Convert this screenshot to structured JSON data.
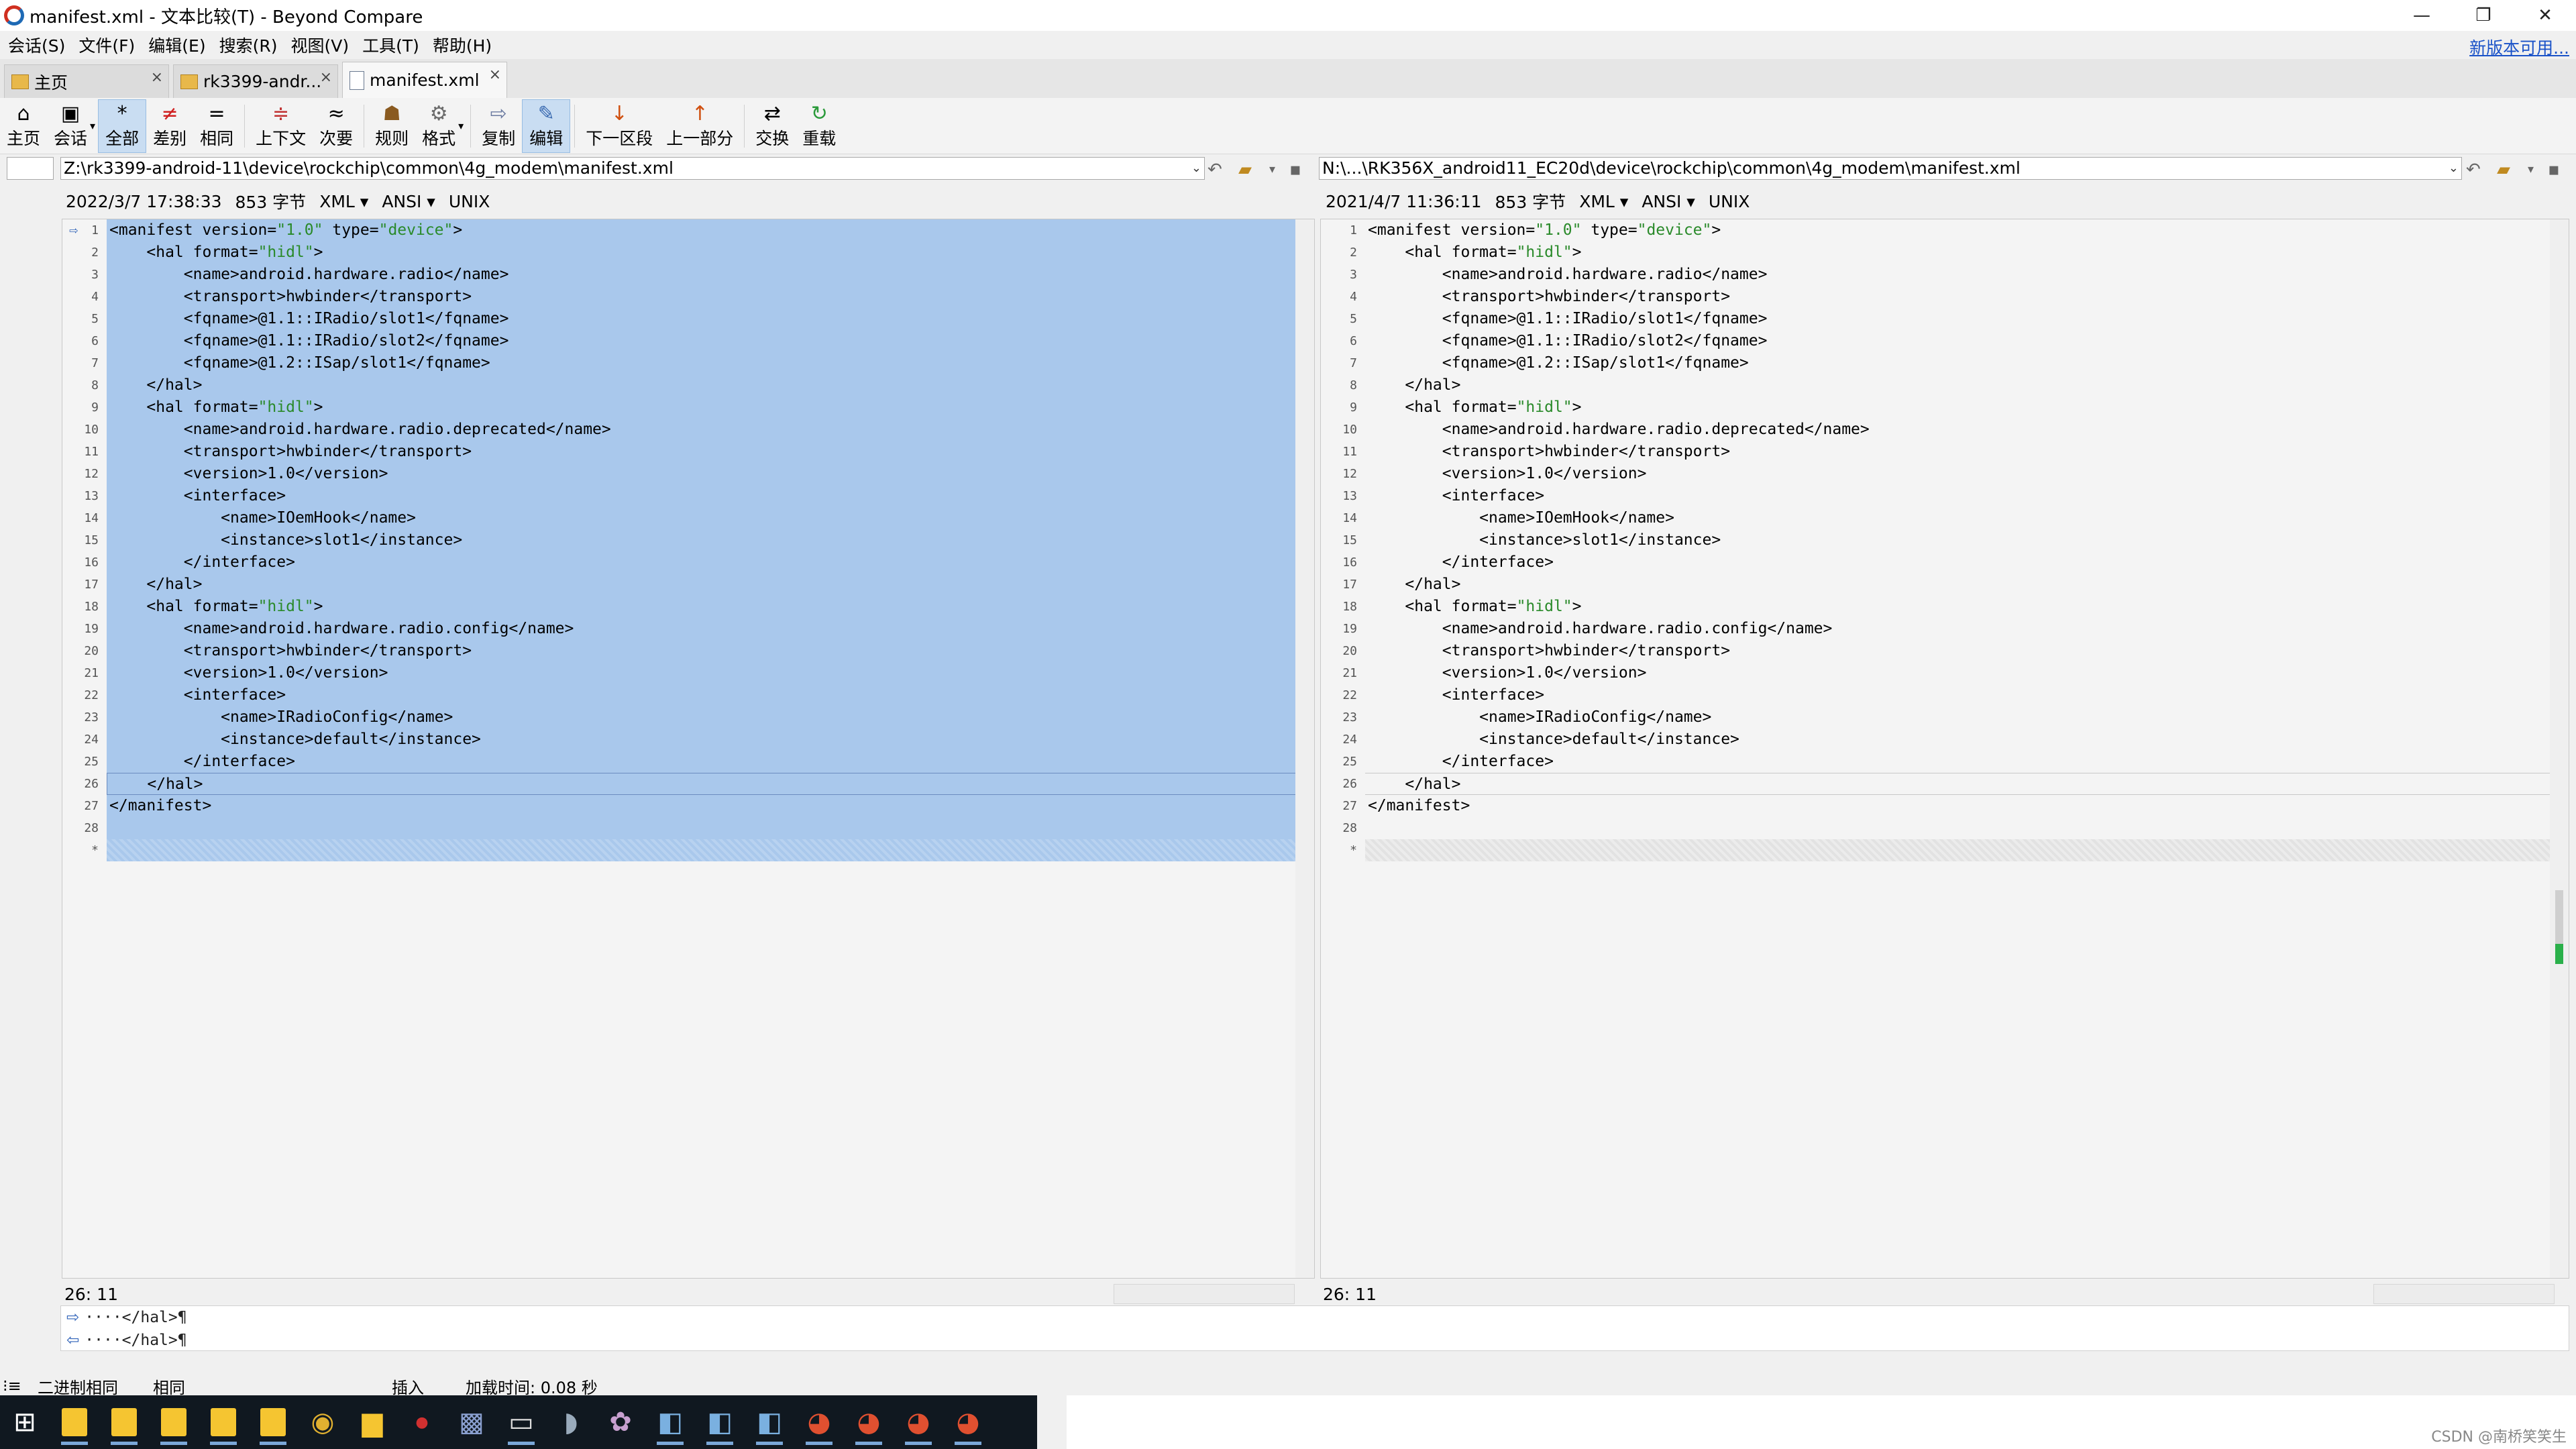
{
  "title": "manifest.xml - 文本比较(T) - Beyond Compare",
  "window_buttons": {
    "minimize": "—",
    "restore": "❐",
    "close": "✕"
  },
  "menu": [
    "会话(S)",
    "文件(F)",
    "编辑(E)",
    "搜索(R)",
    "视图(V)",
    "工具(T)",
    "帮助(H)"
  ],
  "new_version": "新版本可用...",
  "tabs": [
    {
      "label": "主页",
      "close": "×"
    },
    {
      "label": "rk3399-andr...",
      "close": "×"
    },
    {
      "label": "manifest.xml",
      "close": "×"
    }
  ],
  "toolbar": {
    "home": "主页",
    "session": "会话",
    "all": "全部",
    "diffs": "差别",
    "same": "相同",
    "context": "上下文",
    "minor": "次要",
    "rules": "规则",
    "format": "格式",
    "copy": "复制",
    "edit": "编辑",
    "next_section": "下一区段",
    "prev_part": "上一部分",
    "swap": "交换",
    "reload": "重载"
  },
  "left": {
    "path": "Z:\\rk3399-android-11\\device\\rockchip\\common\\4g_modem\\manifest.xml",
    "timestamp": "2022/3/7 17:38:33",
    "size": "853 字节",
    "format": "XML ▾",
    "encoding": "ANSI ▾",
    "eol": "UNIX",
    "pos": "26: 11"
  },
  "right": {
    "path": "N:\\...\\RK356X_android11_EC20d\\device\\rockchip\\common\\4g_modem\\manifest.xml",
    "timestamp": "2021/4/7 11:36:11",
    "size": "853 字节",
    "format": "XML ▾",
    "encoding": "ANSI ▾",
    "eol": "UNIX",
    "pos": "26: 11"
  },
  "lines": [
    "<manifest version=\"1.0\" type=\"device\">",
    "    <hal format=\"hidl\">",
    "        <name>android.hardware.radio</name>",
    "        <transport>hwbinder</transport>",
    "        <fqname>@1.1::IRadio/slot1</fqname>",
    "        <fqname>@1.1::IRadio/slot2</fqname>",
    "        <fqname>@1.2::ISap/slot1</fqname>",
    "    </hal>",
    "    <hal format=\"hidl\">",
    "        <name>android.hardware.radio.deprecated</name>",
    "        <transport>hwbinder</transport>",
    "        <version>1.0</version>",
    "        <interface>",
    "            <name>IOemHook</name>",
    "            <instance>slot1</instance>",
    "        </interface>",
    "    </hal>",
    "    <hal format=\"hidl\">",
    "        <name>android.hardware.radio.config</name>",
    "        <transport>hwbinder</transport>",
    "        <version>1.0</version>",
    "        <interface>",
    "            <name>IRadioConfig</name>",
    "            <instance>default</instance>",
    "        </interface>",
    "    </hal>",
    "</manifest>",
    ""
  ],
  "bottom_lines": [
    "····</hal>¶",
    "····</hal>¶"
  ],
  "status": {
    "binary_same": "二进制相同",
    "same": "相同",
    "insert": "插入",
    "load_time": "加载时间: 0.08 秒"
  },
  "watermark": "CSDN @南桥笑笑生"
}
